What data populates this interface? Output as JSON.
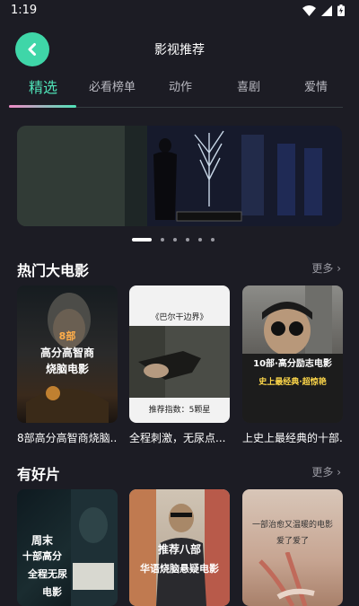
{
  "status": {
    "time": "1:19"
  },
  "header": {
    "title": "影视推荐"
  },
  "tabs": [
    {
      "label": "精选"
    },
    {
      "label": "必看榜单"
    },
    {
      "label": "动作"
    },
    {
      "label": "喜剧"
    },
    {
      "label": "爱情"
    }
  ],
  "carousel": {
    "slide_count": 6,
    "active_index": 0
  },
  "sections": [
    {
      "title": "热门大电影",
      "more": "更多",
      "cards": [
        {
          "caption": "8部高分高智商烧脑...",
          "poster_text": [
            "8部",
            "高分高智商",
            "烧脑电影"
          ]
        },
        {
          "caption": "全程刺激，无尿点...",
          "poster_text": [
            "《巴尔干边界》",
            "推荐指数：5颗星"
          ]
        },
        {
          "caption": "上史上最经典的十部...",
          "poster_text": [
            "10部·高分励志电影",
            "史上最经典·超惊艳"
          ]
        }
      ]
    },
    {
      "title": "有好片",
      "more": "更多",
      "cards": [
        {
          "poster_text": [
            "周末",
            "十部高分",
            "全程无尿",
            "电影"
          ]
        },
        {
          "poster_text": [
            "推荐八部",
            "华语烧脑悬疑电影"
          ]
        },
        {
          "poster_text": [
            "一部治愈又温暖的电影",
            "爱了爱了"
          ]
        }
      ]
    }
  ]
}
